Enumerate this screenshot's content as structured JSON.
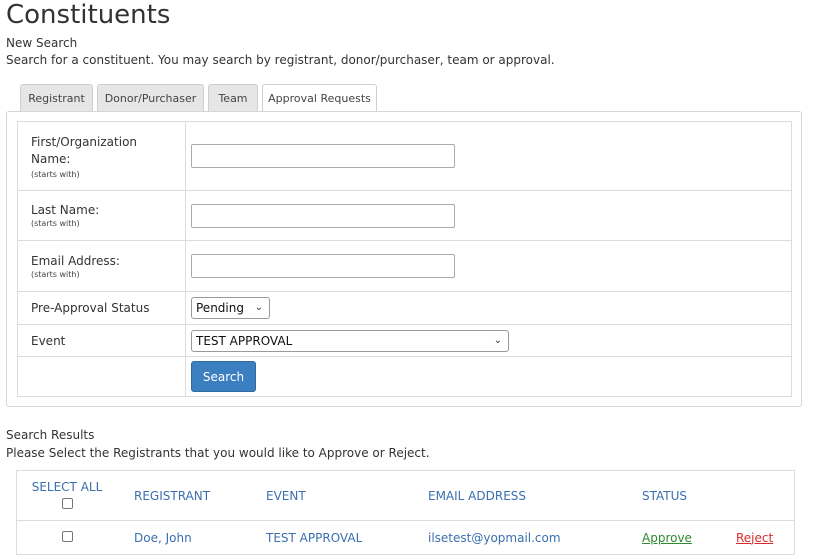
{
  "page": {
    "title": "Constituents",
    "new_search": "New Search",
    "description": "Search for a constituent. You may search by registrant, donor/purchaser, team or approval."
  },
  "tabs": [
    {
      "label": "Registrant",
      "active": false
    },
    {
      "label": "Donor/Purchaser",
      "active": false
    },
    {
      "label": "Team",
      "active": false
    },
    {
      "label": "Approval Requests",
      "active": true
    }
  ],
  "form": {
    "first_name_label": "First/Organization Name:",
    "first_name_hint": "(starts with)",
    "first_name_value": "",
    "last_name_label": "Last Name:",
    "last_name_hint": "(starts with)",
    "last_name_value": "",
    "email_label": "Email Address:",
    "email_hint": "(starts with)",
    "email_value": "",
    "preapproval_label": "Pre-Approval Status",
    "preapproval_selected": "Pending",
    "event_label": "Event",
    "event_selected": "TEST APPROVAL",
    "search_label": "Search"
  },
  "results": {
    "title": "Search Results",
    "description": "Please Select the Registrants that you would like to Approve or Reject.",
    "headers": {
      "select_all": "SELECT ALL",
      "registrant": "REGISTRANT",
      "event": "EVENT",
      "email": "EMAIL ADDRESS",
      "status": "STATUS"
    },
    "rows": [
      {
        "registrant": "Doe, John",
        "event": "TEST APPROVAL",
        "email": "ilsetest@yopmail.com",
        "approve_label": "Approve",
        "reject_label": "Reject"
      }
    ]
  },
  "colors": {
    "link": "#3b6fb0",
    "button": "#3b7fc1",
    "approve": "#2e8b2e",
    "reject": "#d82a2a"
  }
}
